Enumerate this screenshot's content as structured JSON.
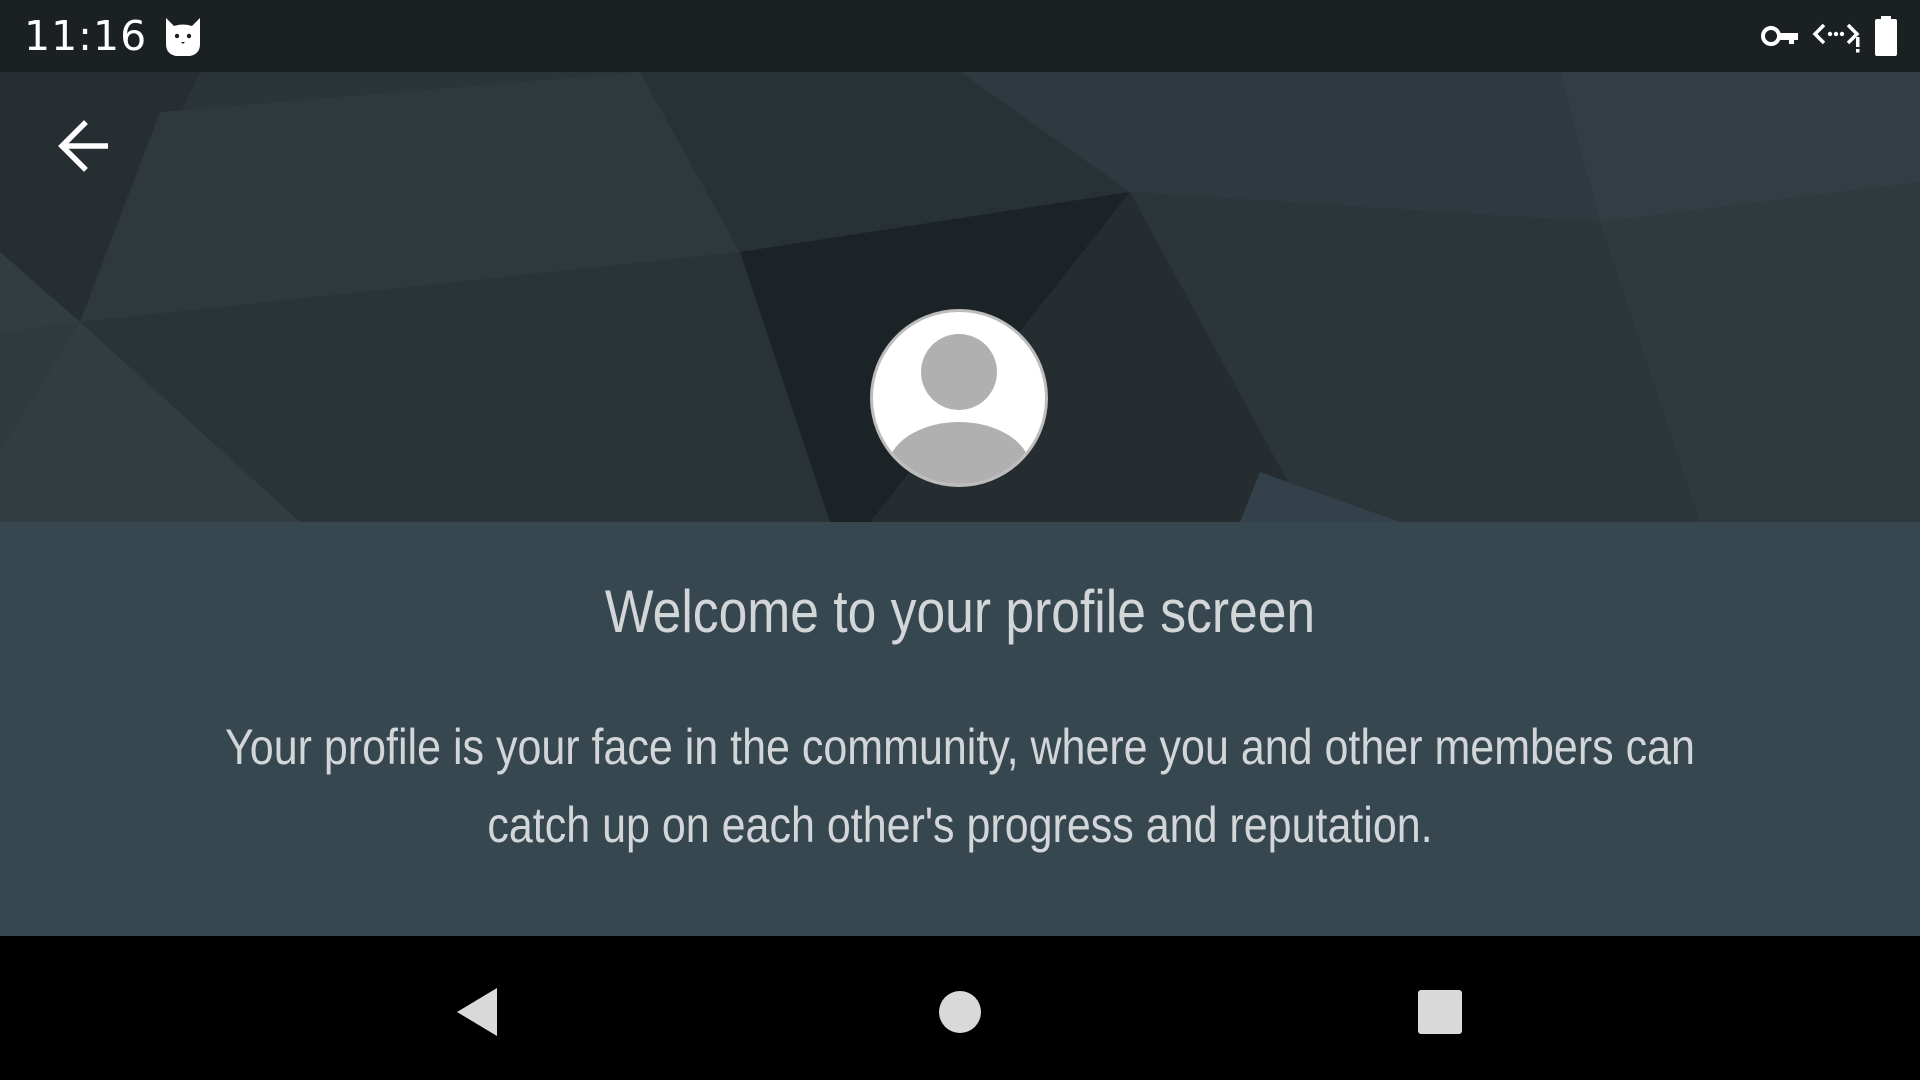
{
  "status_bar": {
    "time": "11:16",
    "icons": [
      "cat-notification-icon",
      "vpn-key-icon",
      "data-saver-icon",
      "battery-icon"
    ]
  },
  "header": {
    "back_icon": "arrow-back-icon",
    "avatar_icon": "default-avatar-icon"
  },
  "content": {
    "title": "Welcome to your profile screen",
    "body": "Your profile is your face in the community, where you and other members can catch up on each other's progress and reputation."
  },
  "nav_bar": {
    "icons": [
      "nav-back-icon",
      "nav-home-icon",
      "nav-recents-icon"
    ]
  },
  "colors": {
    "status_bar_bg": "#1b2023",
    "header_bg": "#2b3439",
    "content_bg": "#37474f",
    "text": "#d3d6d8",
    "nav_bg": "#000000"
  }
}
